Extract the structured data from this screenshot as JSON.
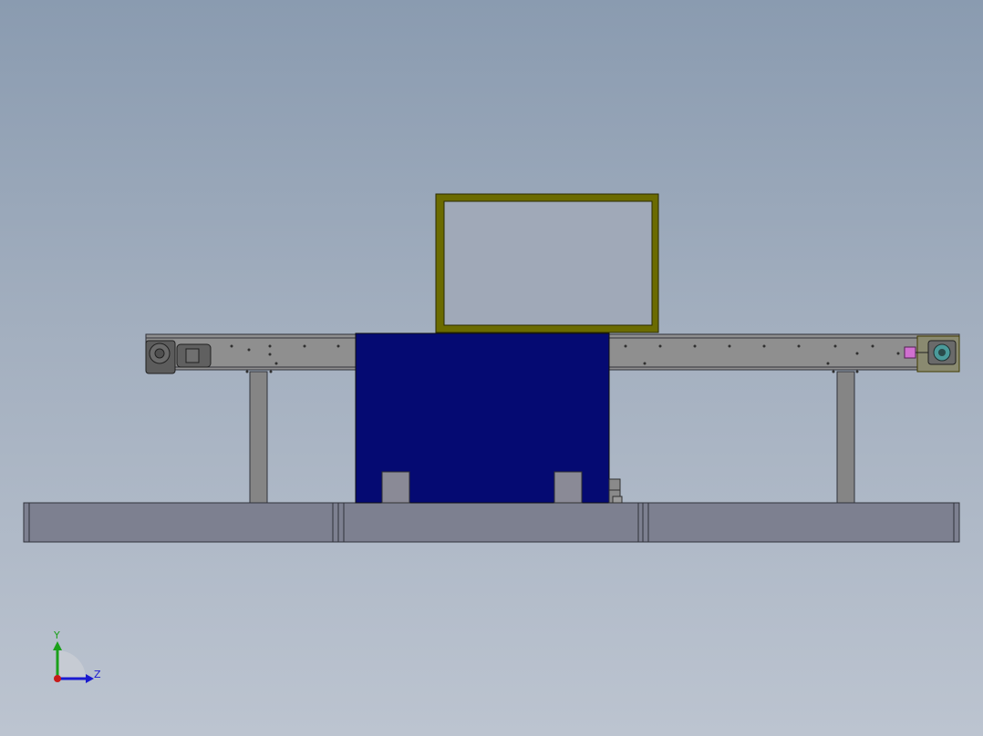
{
  "viewport": {
    "background_top": "#8a9bb0",
    "background_bottom": "#bcc4d0"
  },
  "model": {
    "frame_color": "#6b6b00",
    "cabinet_color": "#050a72",
    "conveyor_color": "#8f8f8f",
    "base_color": "#7d8090",
    "leg_color": "#858585",
    "accent_magenta": "#d070d0",
    "accent_cyan": "#4a9a9a"
  },
  "triad": {
    "y_label": "Y",
    "z_label": "Z",
    "y_color": "#1aa01a",
    "z_color": "#1a1ad0",
    "x_color": "#c81a1a"
  }
}
